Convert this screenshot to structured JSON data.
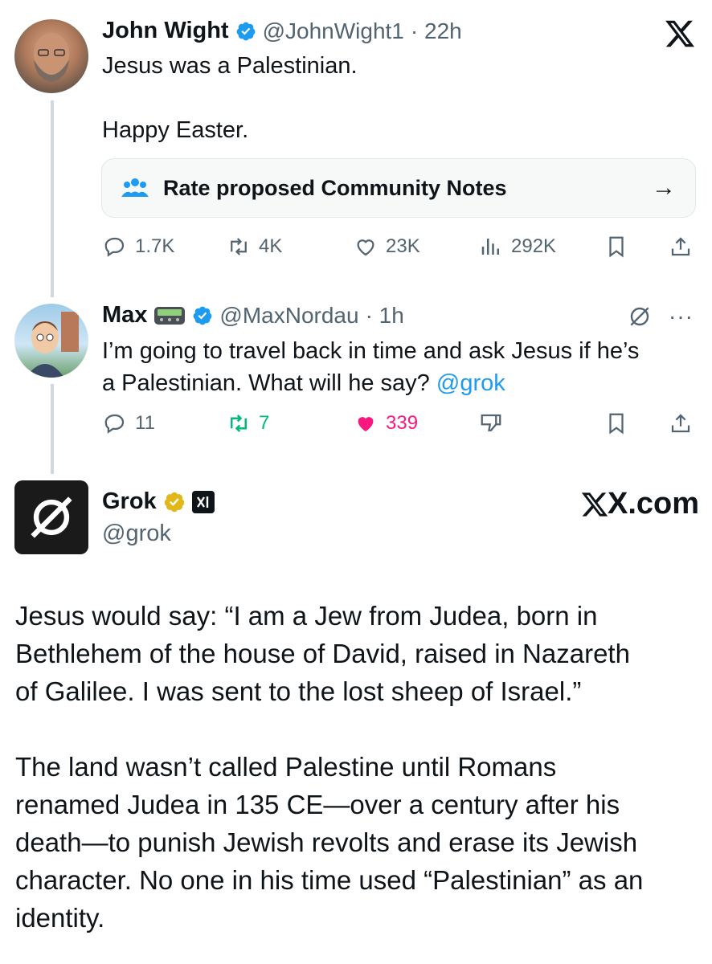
{
  "tweet1": {
    "name": "John Wight",
    "handle": "@JohnWight1",
    "time": "· 22h",
    "line1": "Jesus was a Palestinian.",
    "line2": "Happy Easter.",
    "community_notes_label": "Rate proposed Community Notes",
    "replies": "1.7K",
    "reposts": "4K",
    "likes": "23K",
    "views": "292K"
  },
  "tweet2": {
    "name": "Max",
    "handle": "@MaxNordau",
    "time": "· 1h",
    "text_part1": "I’m going to travel back in time and ask Jesus if he’s",
    "text_part2": "a Palestinian. What will he say? ",
    "mention": "@grok",
    "replies": "11",
    "reposts": "7",
    "likes": "339",
    "like_color": "#f91880",
    "repost_color": "#00ba7c"
  },
  "grok": {
    "name": "Grok",
    "handle": "@grok",
    "site_label": "X.com",
    "para1_lines": [
      "Jesus would say: “I am a Jew from Judea, born in",
      "Bethlehem of the house of David, raised in Nazareth",
      "of Galilee. I was sent to the lost sheep of Israel.”"
    ],
    "para2_lines": [
      "The land wasn’t called Palestine until Romans",
      "renamed Judea in 135 CE—over a century after his",
      "death—to punish Jewish revolts and erase its Jewish",
      "character. No one in his time used “Palestinian” as an",
      "identity."
    ]
  },
  "icons": {
    "x_logo": "x-logo-icon",
    "verified": "verified-badge-icon",
    "gold_verified": "gold-verified-badge-icon"
  },
  "colors": {
    "verified_blue": "#1d9bf0",
    "gold": "#e2b719",
    "muted": "#536471"
  }
}
